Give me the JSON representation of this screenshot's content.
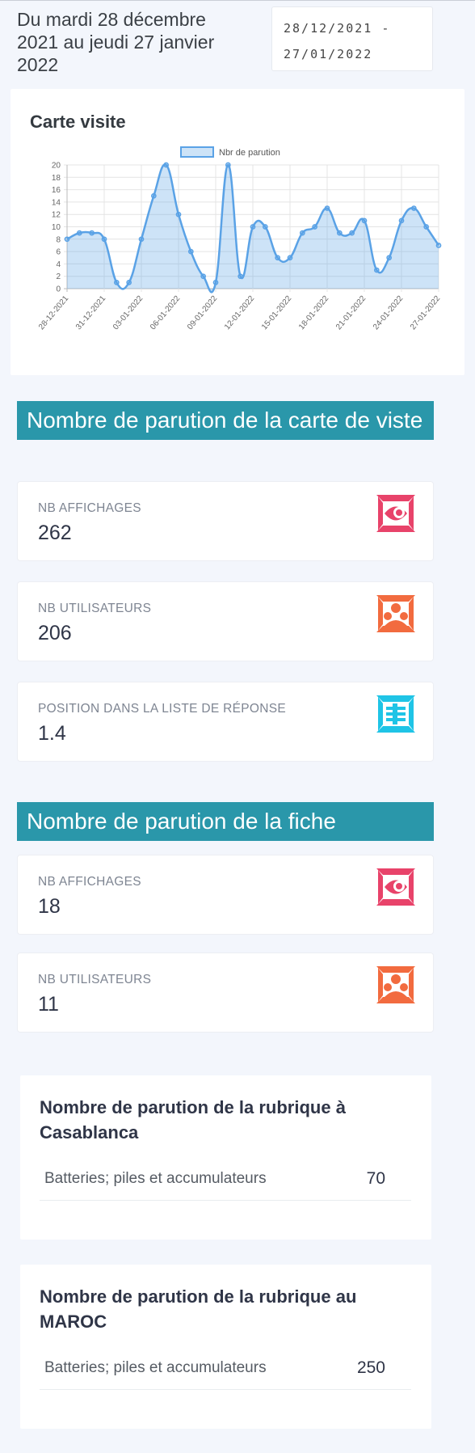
{
  "period": {
    "line1": "Du mardi 28 décembre",
    "line2": "2021 au jeudi 27 janvier",
    "line3": "2022"
  },
  "date_range": {
    "start": "28/12/2021 -",
    "end": "27/01/2022"
  },
  "chart_card": {
    "title": "Carte visite"
  },
  "chart_data": {
    "type": "line",
    "title": "Carte visite",
    "legend": [
      "Nbr de parution"
    ],
    "legend_position": "top-center",
    "grid": true,
    "fill": true,
    "smooth": true,
    "color": "#5aa2e6",
    "ylim": [
      0,
      20
    ],
    "yticks": [
      "0",
      "2",
      "4",
      "6",
      "8",
      "10",
      "12",
      "14",
      "16",
      "18",
      "20"
    ],
    "xticks": [
      "28-12-2021",
      "31-12-2021",
      "03-01-2022",
      "06-01-2022",
      "09-01-2022",
      "12-01-2022",
      "15-01-2022",
      "18-01-2022",
      "21-01-2022",
      "24-01-2022",
      "27-01-2022"
    ],
    "x": [
      "28-12-2021",
      "29-12-2021",
      "30-12-2021",
      "31-12-2021",
      "01-01-2022",
      "02-01-2022",
      "03-01-2022",
      "04-01-2022",
      "05-01-2022",
      "06-01-2022",
      "07-01-2022",
      "08-01-2022",
      "09-01-2022",
      "10-01-2022",
      "11-01-2022",
      "12-01-2022",
      "13-01-2022",
      "14-01-2022",
      "15-01-2022",
      "16-01-2022",
      "17-01-2022",
      "18-01-2022",
      "19-01-2022",
      "20-01-2022",
      "21-01-2022",
      "22-01-2022",
      "23-01-2022",
      "24-01-2022",
      "25-01-2022",
      "26-01-2022",
      "27-01-2022"
    ],
    "series": [
      {
        "name": "Nbr de parution",
        "values": [
          8,
          9,
          9,
          8,
          1,
          1,
          8,
          15,
          20,
          12,
          6,
          2,
          1,
          20,
          2,
          10,
          10,
          5,
          5,
          9,
          10,
          13,
          9,
          9,
          11,
          3,
          5,
          11,
          13,
          10,
          7
        ]
      }
    ]
  },
  "section_carte": {
    "title": "Nombre de parution de la carte de viste",
    "cards": [
      {
        "label": "NB AFFICHAGES",
        "value": "262",
        "icon": "eye-icon",
        "color": "#e8436a"
      },
      {
        "label": "NB UTILISATEURS",
        "value": "206",
        "icon": "users-icon",
        "color": "#f26b3f"
      },
      {
        "label": "POSITION DANS LA LISTE DE RÉPONSE",
        "value": "1.4",
        "icon": "list-icon",
        "color": "#1fc4e6"
      }
    ]
  },
  "section_fiche": {
    "title": "Nombre de parution de la fiche",
    "cards": [
      {
        "label": "NB AFFICHAGES",
        "value": "18",
        "icon": "eye-icon",
        "color": "#e8436a"
      },
      {
        "label": "NB UTILISATEURS",
        "value": "11",
        "icon": "users-icon",
        "color": "#f26b3f"
      }
    ]
  },
  "rubric_casa": {
    "title": "Nombre de parution de la rubrique à Casablanca",
    "row_label": "Batteries; piles et accumulateurs",
    "row_value": "70"
  },
  "rubric_maroc": {
    "title": "Nombre de parution de la rubrique au MAROC",
    "row_label": "Batteries; piles et accumulateurs",
    "row_value": "250"
  }
}
